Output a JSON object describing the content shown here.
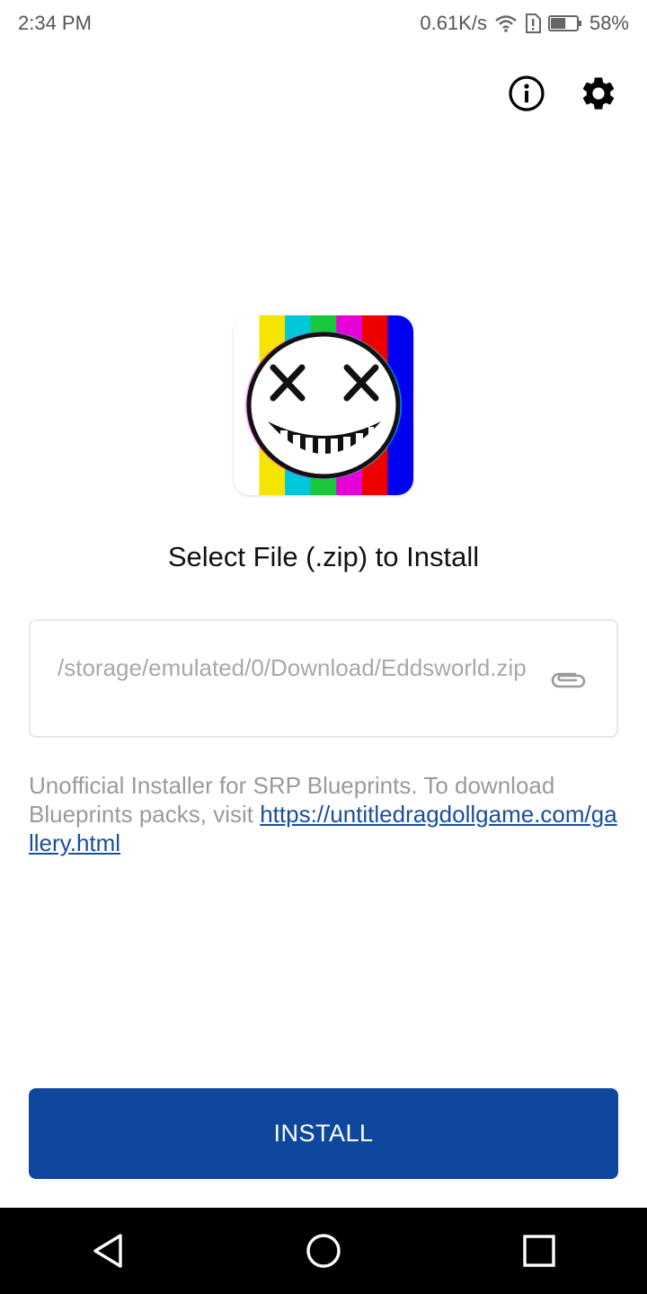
{
  "status_bar": {
    "time": "2:34 PM",
    "network_speed": "0.61K/s",
    "battery_percent": "58%",
    "battery_level": 0.58,
    "icons": [
      "wifi-icon",
      "alert-icon",
      "battery-icon"
    ]
  },
  "toolbar": {
    "icons": [
      "info-icon",
      "settings-gear-icon"
    ]
  },
  "app_icon": {
    "semantic": "glitch-smiley-app-icon",
    "stripe_colors": [
      "#ffffff",
      "#f5e400",
      "#00c8d8",
      "#16c83a",
      "#e800d8",
      "#ee0000",
      "#0000f0"
    ]
  },
  "main": {
    "title": "Select File (.zip) to Install",
    "file_path": "/storage/emulated/0/Download/Eddsworld.zip",
    "attach_icon": "paperclip-icon",
    "description_text": "Unofficial Installer for SRP Blueprints. To download Blueprints packs, visit ",
    "link_text": "https://untitledragdollgame.com/gallery.html"
  },
  "install_button": {
    "label": "INSTALL",
    "color": "#0f479e"
  },
  "nav_bar": {
    "icons": [
      "back-triangle-icon",
      "home-circle-icon",
      "recents-square-icon"
    ]
  }
}
